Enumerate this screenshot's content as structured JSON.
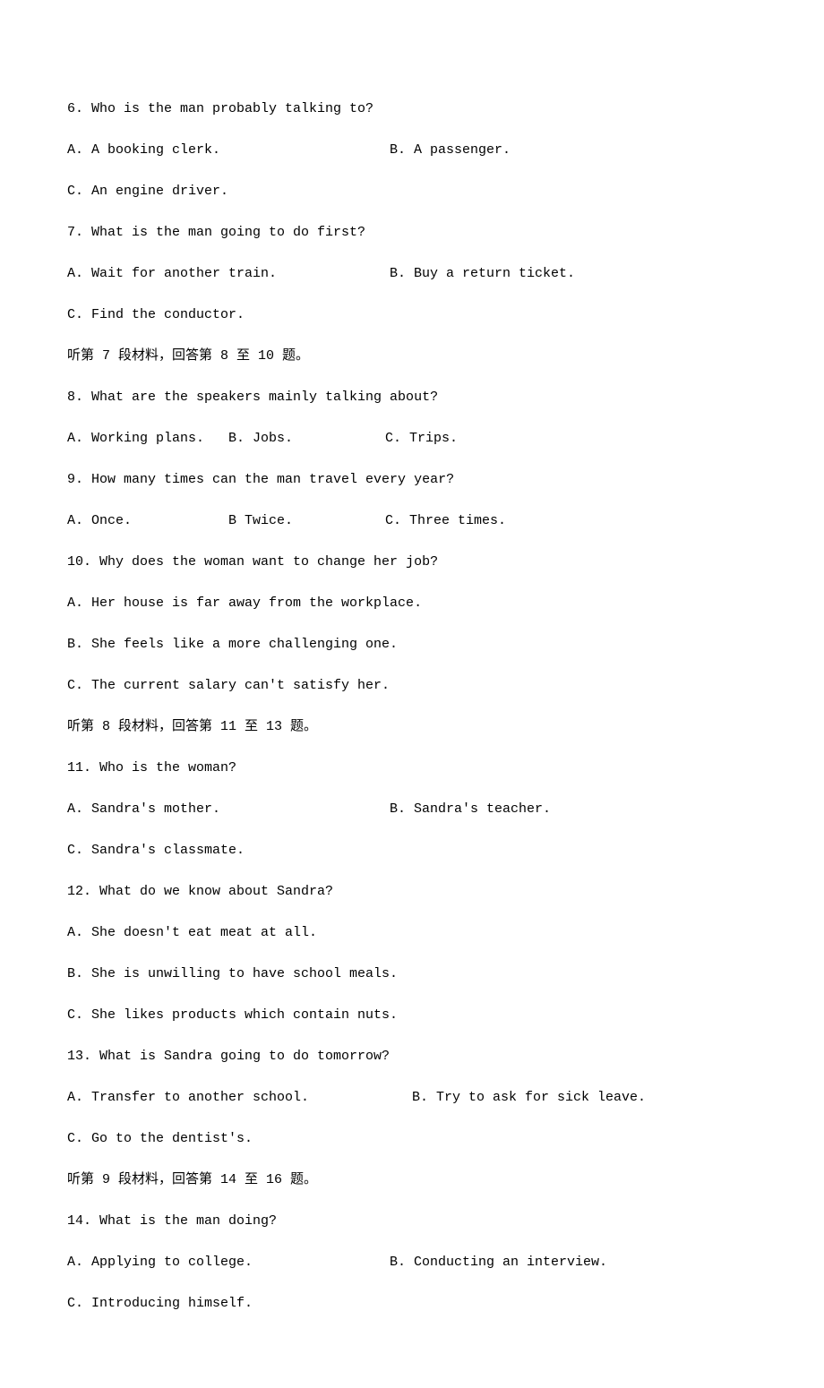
{
  "q6": {
    "text": "6. Who is the man probably talking to?",
    "a": "A. A booking clerk.",
    "b": "B. A passenger.",
    "c": "C. An engine driver."
  },
  "q7": {
    "text": "7. What is the man going to do first?",
    "a": "A. Wait for another train.",
    "b": "B. Buy a return ticket.",
    "c": "C. Find the conductor."
  },
  "section7": "听第 7 段材料，回答第 8 至 10 题。",
  "q8": {
    "text": "8. What are the speakers mainly talking about?",
    "a": "A. Working plans.",
    "b": "B. Jobs.",
    "c": "C. Trips."
  },
  "q9": {
    "text": "9. How many times can the man travel every year?",
    "a": "A. Once.",
    "b": "B Twice.",
    "c": "C. Three times."
  },
  "q10": {
    "text": "10. Why does the woman want to change her job?",
    "a": "A. Her house is far away from the workplace.",
    "b": "B. She feels like a more challenging one.",
    "c": "C. The current salary can't satisfy her."
  },
  "section8": "听第 8 段材料，回答第 11 至 13 题。",
  "q11": {
    "text": "11. Who is the woman?",
    "a": "A. Sandra's mother.",
    "b": "B. Sandra's teacher.",
    "c": "C. Sandra's classmate."
  },
  "q12": {
    "text": "12. What do we know about Sandra?",
    "a": "A. She doesn't eat meat at all.",
    "b": "B. She is unwilling to have school meals.",
    "c": "C. She likes products which contain nuts."
  },
  "q13": {
    "text": "13. What is Sandra going to do tomorrow?",
    "a": "A. Transfer to another school.",
    "b": "B. Try to ask for sick leave.",
    "c": "C. Go to the dentist's."
  },
  "section9": "听第 9 段材料，回答第 14 至 16 题。",
  "q14": {
    "text": "14. What is the man doing?",
    "a": "A. Applying to college.",
    "b": "B. Conducting an interview.",
    "c": "C. Introducing himself."
  }
}
